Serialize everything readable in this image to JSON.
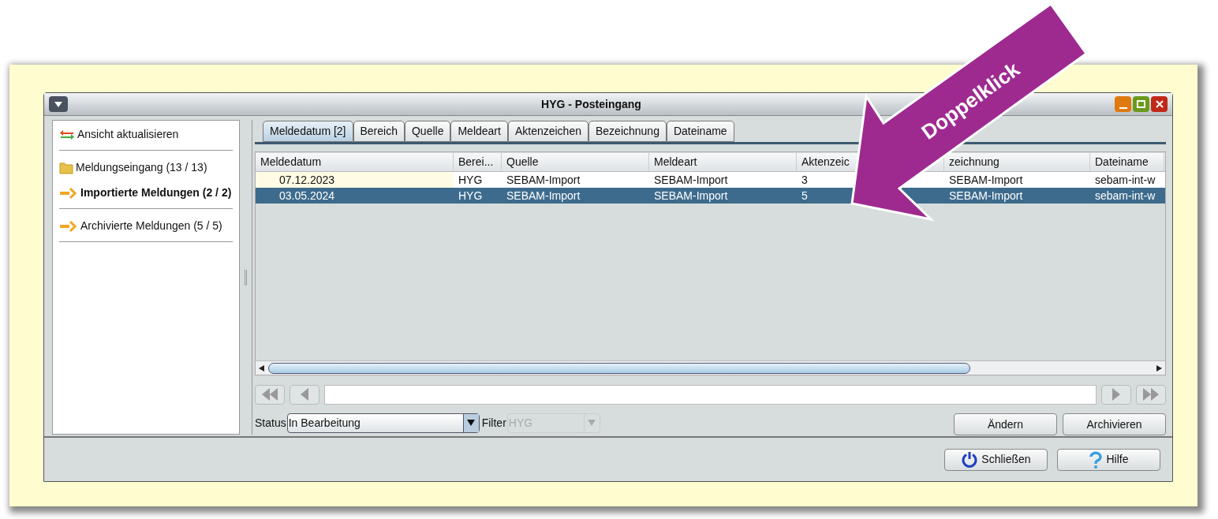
{
  "window": {
    "title": "HYG - Posteingang"
  },
  "sidebar": {
    "groups": [
      [
        {
          "kind": "refresh",
          "label": "Ansicht aktualisieren",
          "selected": false
        }
      ],
      [
        {
          "kind": "folder",
          "label": "Meldungseingang (13 / 13)",
          "selected": false
        },
        {
          "kind": "arrow",
          "label": "Importierte Meldungen (2 / 2)",
          "selected": true
        }
      ],
      [
        {
          "kind": "arrow",
          "label": "Archivierte Meldungen (5 / 5)",
          "selected": false
        }
      ]
    ]
  },
  "tabs": [
    {
      "label": "Meldedatum [2]",
      "selected": true
    },
    {
      "label": "Bereich",
      "selected": false
    },
    {
      "label": "Quelle",
      "selected": false
    },
    {
      "label": "Meldeart",
      "selected": false
    },
    {
      "label": "Aktenzeichen",
      "selected": false
    },
    {
      "label": "Bezeichnung",
      "selected": false
    },
    {
      "label": "Dateiname",
      "selected": false
    }
  ],
  "table": {
    "columns": [
      "Meldedatum",
      "Berei...",
      "Quelle",
      "Meldeart",
      "Aktenzeic",
      "zeichnung",
      "Dateiname"
    ],
    "rows": [
      {
        "selected": false,
        "focused": true,
        "cells": [
          "07.12.2023",
          "HYG",
          "SEBAM-Import",
          "SEBAM-Import",
          "3",
          "SEBAM-Import",
          "sebam-int-w"
        ]
      },
      {
        "selected": true,
        "focused": false,
        "cells": [
          "03.05.2024",
          "HYG",
          "SEBAM-Import",
          "SEBAM-Import",
          "5",
          "SEBAM-Import",
          "sebam-int-w"
        ]
      }
    ]
  },
  "status": {
    "label": "Status",
    "value": "In Bearbeitung"
  },
  "filter": {
    "label": "Filter",
    "value": "HYG",
    "disabled": true
  },
  "actions": [
    "Ändern",
    "Archivieren"
  ],
  "footer": [
    {
      "kind": "power",
      "label": "Schließen"
    },
    {
      "kind": "help",
      "label": "Hilfe"
    }
  ],
  "annotation": {
    "label": "Doppelklick"
  }
}
